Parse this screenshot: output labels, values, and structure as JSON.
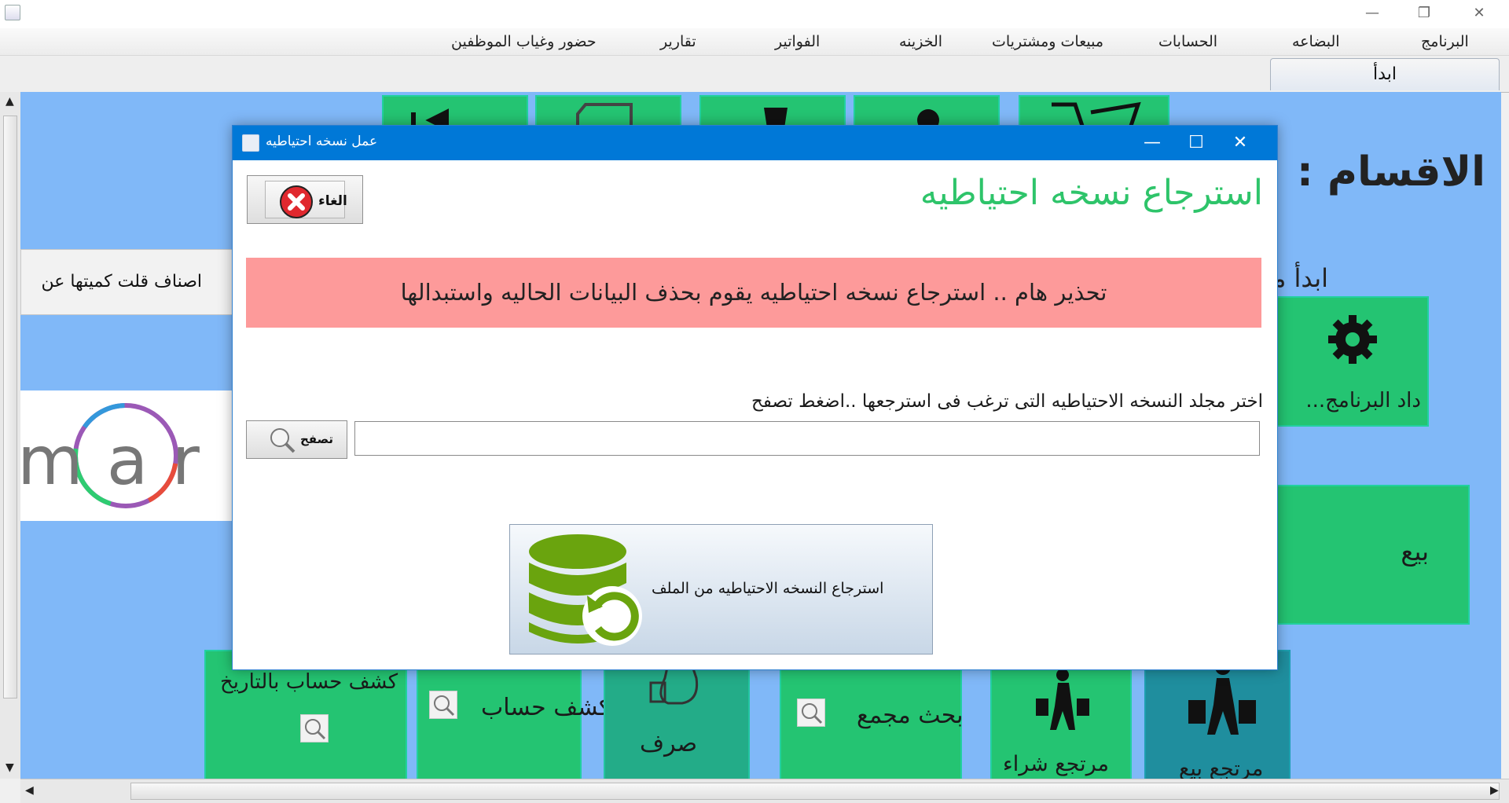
{
  "window": {
    "controls": {
      "minimize": "—",
      "restore": "❐",
      "close": "✕"
    }
  },
  "menu": {
    "items": [
      "البرنامج",
      "البضاعه",
      "الحسابات",
      "مبيعات ومشتريات",
      "الخزينه",
      "الفواتير",
      "تقارير",
      "حضور وغياب الموظفين"
    ]
  },
  "tabs": {
    "start": "ابدأ"
  },
  "main": {
    "sections_heading": "الاقسام :",
    "start_here": "ابدأ من هنا",
    "low_stock_label": "اصناف قلت كميتها عن",
    "logo_text": "mar",
    "settings_tile_label": "داد البرنامج...",
    "sell_tile_label": "بيع",
    "tiles": {
      "account_by_date": "كشف حساب بالتاريخ",
      "account_statement": "كشف حساب",
      "expense": "صرف",
      "aggregate_search": "بحث مجمع",
      "purchase_return": "مرتجع شراء",
      "sales_return": "مرتجع بيع"
    },
    "colors": {
      "background": "#80b8f8",
      "tile": "#24c472",
      "tile_dark": "#1f8e9e"
    }
  },
  "dialog": {
    "title": "عمل نسخه احتياطيه",
    "heading": "استرجاع نسخه احتياطيه",
    "cancel_label": "الغاء",
    "warning": "تحذير هام .. استرجاع نسخه احتياطيه يقوم بحذف البيانات الحاليه واستبدالها",
    "choose_folder_label": "اختر مجلد النسخه الاحتياطيه التى ترغب فى استرجعها ..اضغط تصفح",
    "browse_label": "تصفح",
    "path_value": "",
    "restore_label": "استرجاع النسخه الاحتياطيه من الملف",
    "colors": {
      "heading": "#2ec46a",
      "warning_bg": "#fd9a9a",
      "titlebar": "#0078d7"
    }
  }
}
